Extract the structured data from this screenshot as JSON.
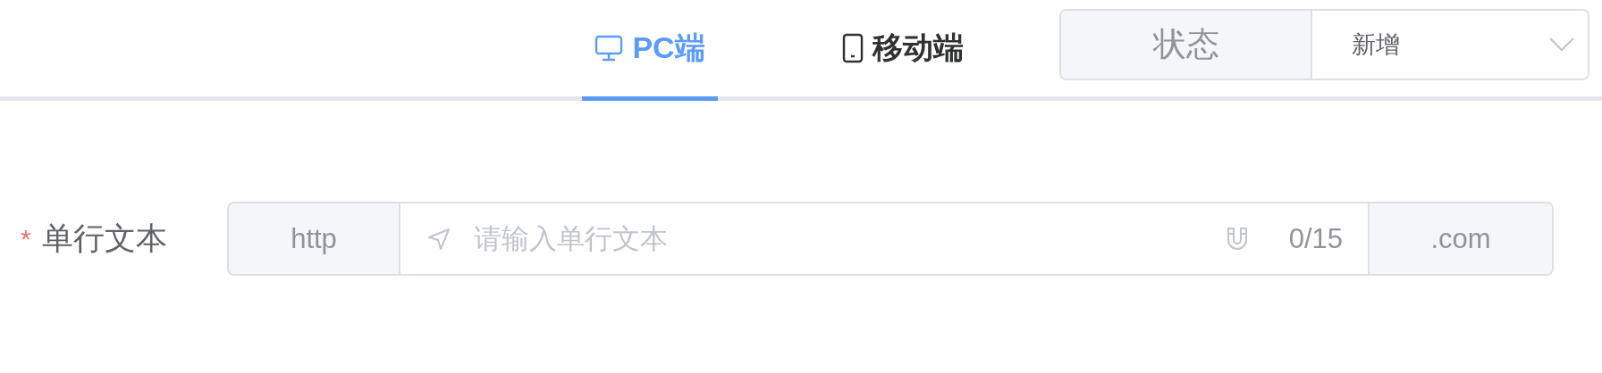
{
  "tabs": [
    {
      "label": "PC端",
      "kind": "desktop",
      "selected": true
    },
    {
      "label": "移动端",
      "kind": "mobile",
      "selected": false
    }
  ],
  "status": {
    "label": "状态",
    "value": "新增"
  },
  "field": {
    "label": "单行文本",
    "required": true,
    "required_mark": "*",
    "prepend": "http",
    "placeholder": "请输入单行文本",
    "counter": "0/15",
    "append": ".com"
  }
}
